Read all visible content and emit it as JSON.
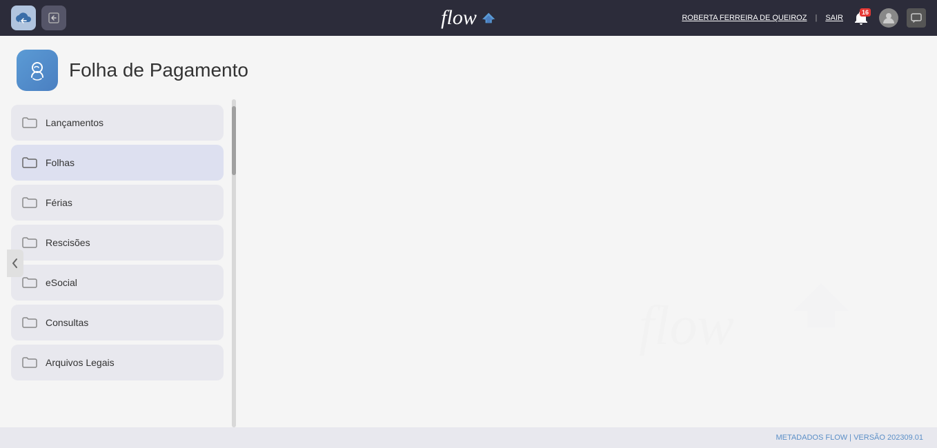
{
  "header": {
    "logo_text": "flow",
    "user_name": "ROBERTA FERREIRA DE QUEIROZ",
    "logout_label": "SAIR",
    "notification_count": "16"
  },
  "page": {
    "title": "Folha de Pagamento"
  },
  "nav": {
    "items": [
      {
        "id": "lancamentos",
        "label": "Lançamentos",
        "active": false
      },
      {
        "id": "folhas",
        "label": "Folhas",
        "active": true
      },
      {
        "id": "ferias",
        "label": "Férias",
        "active": false
      },
      {
        "id": "rescisoes",
        "label": "Rescisões",
        "active": false
      },
      {
        "id": "esocial",
        "label": "eSocial",
        "active": false
      },
      {
        "id": "consultas",
        "label": "Consultas",
        "active": false
      },
      {
        "id": "arquivos-legais",
        "label": "Arquivos Legais",
        "active": false
      }
    ]
  },
  "footer": {
    "text": "METADADOS FLOW | VERSÃO 202309.01"
  }
}
